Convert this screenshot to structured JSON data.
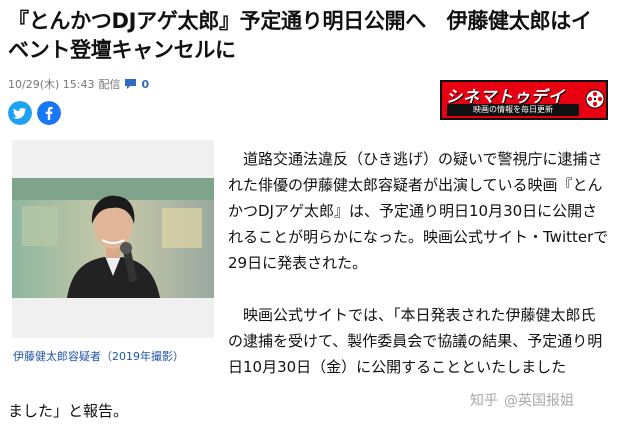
{
  "article": {
    "headline": "『とんかつDJアゲ太郎』予定通り明日公開へ　伊藤健太郎はイベント登壇キャンセルに",
    "date": "10/29(木) 15:43",
    "source_label": "配信",
    "comment_count": "0"
  },
  "share": {
    "twitter_icon": "twitter-bird-icon",
    "facebook_icon": "facebook-f-icon",
    "twitter_color": "#1da1f2",
    "facebook_color": "#1877f2"
  },
  "brand": {
    "name": "シネマトゥデイ",
    "tagline": "映画の情報を毎日更新",
    "color": "#e60012"
  },
  "photo": {
    "caption": "伊藤健太郎容疑者（2019年撮影）"
  },
  "body": {
    "paragraph1": "道路交通法違反（ひき逃げ）の疑いで警視庁に逮捕された俳優の伊藤健太郎容疑者が出演している映画『とんかつDJアゲ太郎』は、予定通り明日10月30日に公開されることが明らかになった。映画公式サイト・Twitterで29日に発表された。",
    "paragraph2": "映画公式サイトでは、「本日発表された伊藤健太郎氏の逮捕を受けて、製作委員会で協議の結果、予定通り明日10月30日（金）に公開することといたしました",
    "paragraph2_end": "ました」と報告。"
  },
  "watermark": {
    "site": "知乎",
    "author": "@英国报姐"
  }
}
